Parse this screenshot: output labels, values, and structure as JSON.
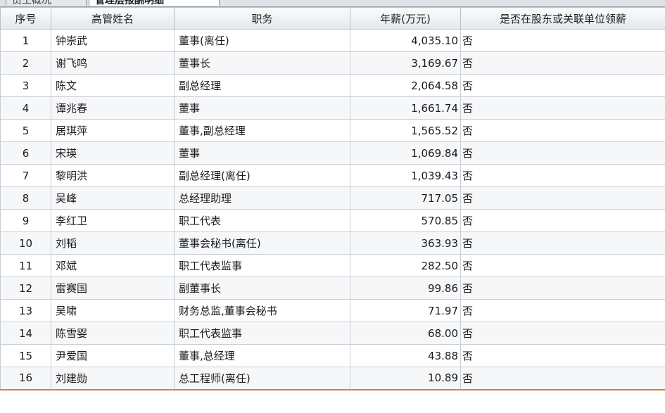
{
  "tabs": [
    {
      "label": "员工概况"
    },
    {
      "label": "管理层报酬明细"
    }
  ],
  "table": {
    "headers": {
      "index": "序号",
      "name": "高管姓名",
      "position": "职务",
      "salary": "年薪(万元)",
      "paid_by_related": "是否在股东或关联单位领薪"
    },
    "rows": [
      {
        "index": "1",
        "name": "钟崇武",
        "position": "董事(离任)",
        "salary": "4,035.10",
        "paid_by_related": "否"
      },
      {
        "index": "2",
        "name": "谢飞鸣",
        "position": "董事长",
        "salary": "3,169.67",
        "paid_by_related": "否"
      },
      {
        "index": "3",
        "name": "陈文",
        "position": "副总经理",
        "salary": "2,064.58",
        "paid_by_related": "否"
      },
      {
        "index": "4",
        "name": "谭兆春",
        "position": "董事",
        "salary": "1,661.74",
        "paid_by_related": "否"
      },
      {
        "index": "5",
        "name": "居琪萍",
        "position": "董事,副总经理",
        "salary": "1,565.52",
        "paid_by_related": "否"
      },
      {
        "index": "6",
        "name": "宋瑛",
        "position": "董事",
        "salary": "1,069.84",
        "paid_by_related": "否"
      },
      {
        "index": "7",
        "name": "黎明洪",
        "position": "副总经理(离任)",
        "salary": "1,039.43",
        "paid_by_related": "否"
      },
      {
        "index": "8",
        "name": "吴峰",
        "position": "总经理助理",
        "salary": "717.05",
        "paid_by_related": "否"
      },
      {
        "index": "9",
        "name": "李红卫",
        "position": "职工代表",
        "salary": "570.85",
        "paid_by_related": "否"
      },
      {
        "index": "10",
        "name": "刘韬",
        "position": "董事会秘书(离任)",
        "salary": "363.93",
        "paid_by_related": "否"
      },
      {
        "index": "11",
        "name": "邓斌",
        "position": "职工代表监事",
        "salary": "282.50",
        "paid_by_related": "否"
      },
      {
        "index": "12",
        "name": "雷赛国",
        "position": "副董事长",
        "salary": "99.86",
        "paid_by_related": "否"
      },
      {
        "index": "13",
        "name": "吴啸",
        "position": "财务总监,董事会秘书",
        "salary": "71.97",
        "paid_by_related": "否"
      },
      {
        "index": "14",
        "name": "陈雪婴",
        "position": "职工代表监事",
        "salary": "68.00",
        "paid_by_related": "否"
      },
      {
        "index": "15",
        "name": "尹爱国",
        "position": "董事,总经理",
        "salary": "43.88",
        "paid_by_related": "否"
      },
      {
        "index": "16",
        "name": "刘建勋",
        "position": "总工程师(离任)",
        "salary": "10.89",
        "paid_by_related": "否"
      }
    ]
  }
}
